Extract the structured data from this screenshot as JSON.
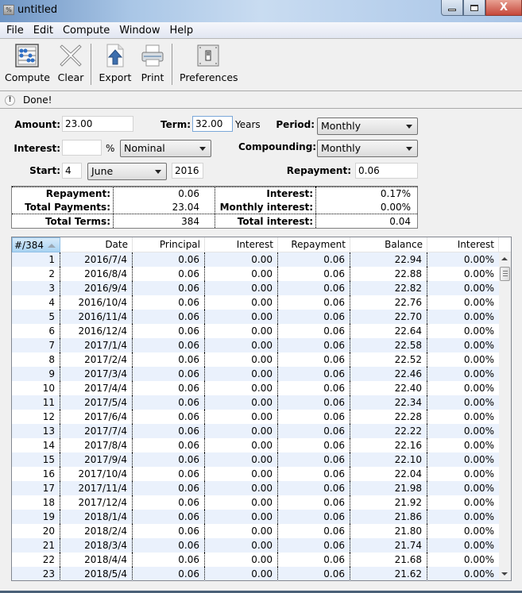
{
  "window": {
    "title": "untitled",
    "controls": {
      "minimize": "–",
      "maximize": "□",
      "close": "X"
    }
  },
  "menu": [
    "File",
    "Edit",
    "Compute",
    "Window",
    "Help"
  ],
  "toolbar": {
    "compute": "Compute",
    "clear": "Clear",
    "export": "Export",
    "print": "Print",
    "preferences": "Preferences"
  },
  "status": {
    "icon": "!",
    "text": "Done!"
  },
  "form": {
    "amount_label": "Amount:",
    "amount_value": "23.00",
    "term_label": "Term:",
    "term_value": "32.00",
    "term_unit": "Years",
    "period_label": "Period:",
    "period_value": "Monthly",
    "interest_label": "Interest:",
    "interest_value": "",
    "interest_unit": "%",
    "interest_type": "Nominal",
    "compounding_label": "Compounding:",
    "compounding_value": "Monthly",
    "start_label": "Start:",
    "start_day": "4",
    "start_month": "June",
    "start_year": "2016",
    "repayment_label": "Repayment:",
    "repayment_value": "0.06"
  },
  "summary": {
    "repayment_label": "Repayment:",
    "repayment_value": "0.06",
    "total_payments_label": "Total Payments:",
    "total_payments_value": "23.04",
    "total_terms_label": "Total Terms:",
    "total_terms_value": "384",
    "interest_label": "Interest:",
    "interest_value": "0.17%",
    "monthly_interest_label": "Monthly interest:",
    "monthly_interest_value": "0.00%",
    "total_interest_label": "Total interest:",
    "total_interest_value": "0.04"
  },
  "table": {
    "columns": [
      "#/384",
      "Date",
      "Principal",
      "Interest",
      "Repayment",
      "Balance",
      "Interest"
    ],
    "rows": [
      [
        "1",
        "2016/7/4",
        "0.06",
        "0.00",
        "0.06",
        "22.94",
        "0.00%"
      ],
      [
        "2",
        "2016/8/4",
        "0.06",
        "0.00",
        "0.06",
        "22.88",
        "0.00%"
      ],
      [
        "3",
        "2016/9/4",
        "0.06",
        "0.00",
        "0.06",
        "22.82",
        "0.00%"
      ],
      [
        "4",
        "2016/10/4",
        "0.06",
        "0.00",
        "0.06",
        "22.76",
        "0.00%"
      ],
      [
        "5",
        "2016/11/4",
        "0.06",
        "0.00",
        "0.06",
        "22.70",
        "0.00%"
      ],
      [
        "6",
        "2016/12/4",
        "0.06",
        "0.00",
        "0.06",
        "22.64",
        "0.00%"
      ],
      [
        "7",
        "2017/1/4",
        "0.06",
        "0.00",
        "0.06",
        "22.58",
        "0.00%"
      ],
      [
        "8",
        "2017/2/4",
        "0.06",
        "0.00",
        "0.06",
        "22.52",
        "0.00%"
      ],
      [
        "9",
        "2017/3/4",
        "0.06",
        "0.00",
        "0.06",
        "22.46",
        "0.00%"
      ],
      [
        "10",
        "2017/4/4",
        "0.06",
        "0.00",
        "0.06",
        "22.40",
        "0.00%"
      ],
      [
        "11",
        "2017/5/4",
        "0.06",
        "0.00",
        "0.06",
        "22.34",
        "0.00%"
      ],
      [
        "12",
        "2017/6/4",
        "0.06",
        "0.00",
        "0.06",
        "22.28",
        "0.00%"
      ],
      [
        "13",
        "2017/7/4",
        "0.06",
        "0.00",
        "0.06",
        "22.22",
        "0.00%"
      ],
      [
        "14",
        "2017/8/4",
        "0.06",
        "0.00",
        "0.06",
        "22.16",
        "0.00%"
      ],
      [
        "15",
        "2017/9/4",
        "0.06",
        "0.00",
        "0.06",
        "22.10",
        "0.00%"
      ],
      [
        "16",
        "2017/10/4",
        "0.06",
        "0.00",
        "0.06",
        "22.04",
        "0.00%"
      ],
      [
        "17",
        "2017/11/4",
        "0.06",
        "0.00",
        "0.06",
        "21.98",
        "0.00%"
      ],
      [
        "18",
        "2017/12/4",
        "0.06",
        "0.00",
        "0.06",
        "21.92",
        "0.00%"
      ],
      [
        "19",
        "2018/1/4",
        "0.06",
        "0.00",
        "0.06",
        "21.86",
        "0.00%"
      ],
      [
        "20",
        "2018/2/4",
        "0.06",
        "0.00",
        "0.06",
        "21.80",
        "0.00%"
      ],
      [
        "21",
        "2018/3/4",
        "0.06",
        "0.00",
        "0.06",
        "21.74",
        "0.00%"
      ],
      [
        "22",
        "2018/4/4",
        "0.06",
        "0.00",
        "0.06",
        "21.68",
        "0.00%"
      ],
      [
        "23",
        "2018/5/4",
        "0.06",
        "0.00",
        "0.06",
        "21.62",
        "0.00%"
      ]
    ]
  }
}
